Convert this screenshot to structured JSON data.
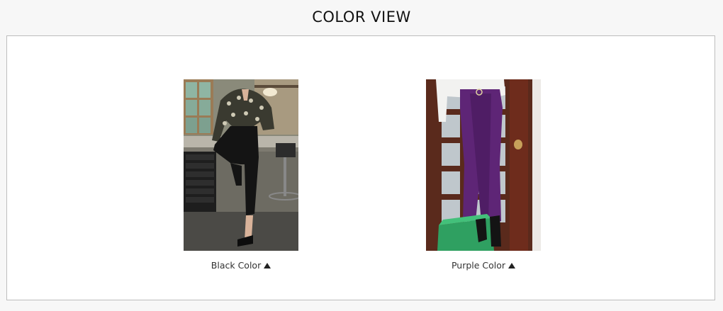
{
  "header": {
    "title": "COLOR VIEW"
  },
  "colors": [
    {
      "label": "Black Color",
      "image_icon": "model-black-pants-photo",
      "swatch": "#111111"
    },
    {
      "label": "Purple Color",
      "image_icon": "model-purple-pants-photo",
      "swatch": "#5e2576"
    }
  ],
  "indicator_icon": "triangle-up-icon"
}
